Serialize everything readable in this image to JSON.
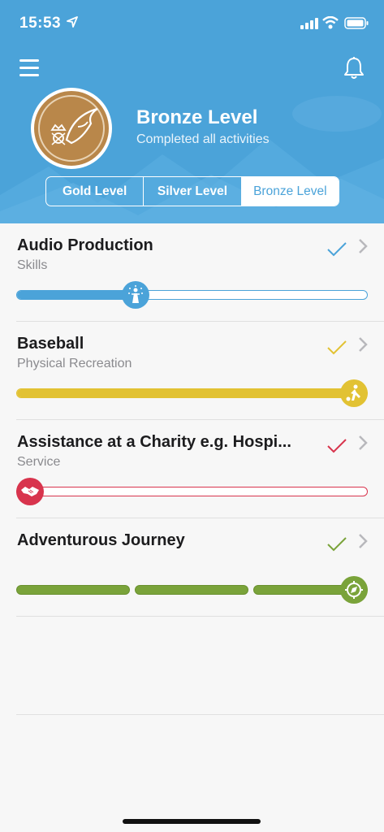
{
  "status_bar": {
    "time": "15:53"
  },
  "header": {
    "level_title": "Bronze Level",
    "level_subtitle": "Completed all activities",
    "tabs": [
      {
        "label": "Gold Level",
        "active": false
      },
      {
        "label": "Silver Level",
        "active": false
      },
      {
        "label": "Bronze Level",
        "active": true
      }
    ]
  },
  "colors": {
    "header_bg": "#4ba3d9",
    "skills": "#4ba3d9",
    "physical": "#e2c233",
    "service": "#d8344d",
    "journey": "#7aa33a",
    "bronze": "#b9874a"
  },
  "activities": [
    {
      "title": "Audio Production",
      "category": "Skills",
      "progress": 0.34,
      "icon": "person-sparkle-icon"
    },
    {
      "title": "Baseball",
      "category": "Physical Recreation",
      "progress": 1.0,
      "icon": "bowling-player-icon"
    },
    {
      "title": "Assistance at a Charity e.g. Hospi...",
      "category": "Service",
      "progress": 0.0,
      "icon": "handshake-icon"
    },
    {
      "title": "Adventurous Journey",
      "category": "",
      "progress": 1.0,
      "icon": "compass-icon"
    }
  ]
}
